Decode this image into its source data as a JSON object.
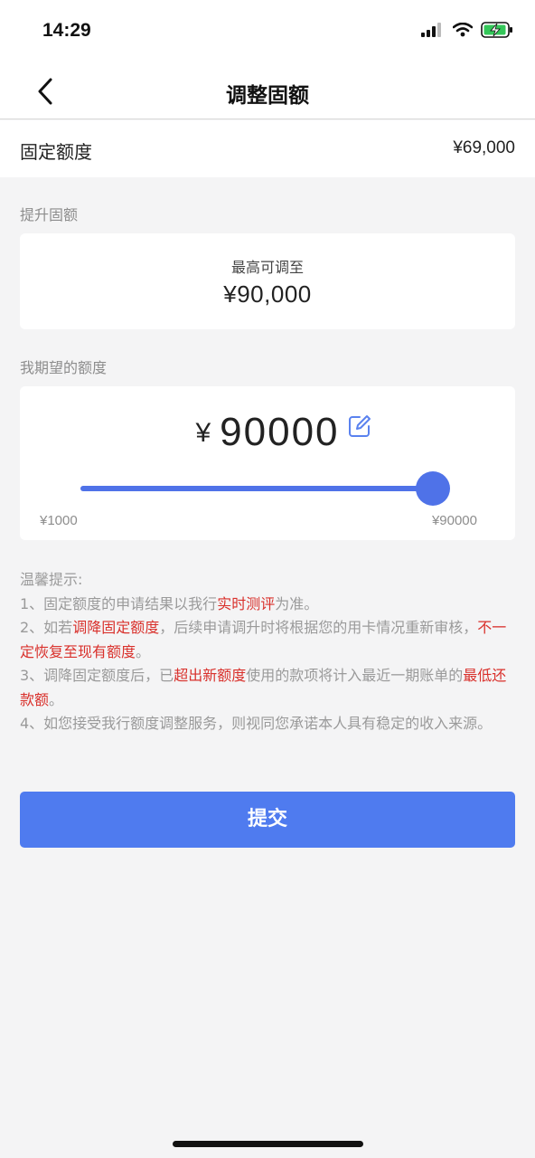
{
  "status_bar": {
    "time": "14:29"
  },
  "nav": {
    "title": "调整固额"
  },
  "fixed_quota": {
    "label": "固定额度",
    "value": "¥69,000"
  },
  "raise_section": {
    "label": "提升固额",
    "max_caption": "最高可调至",
    "max_value": "¥90,000"
  },
  "desired_section": {
    "label": "我期望的额度",
    "currency": "¥",
    "amount": "90000",
    "slider": {
      "min_label": "¥1000",
      "max_label": "¥90000",
      "min": 1000,
      "max": 90000,
      "value": 90000
    }
  },
  "tips": {
    "title": "温馨提示:",
    "item1": {
      "pre": "1、固定额度的申请结果以我行",
      "hl": "实时测评",
      "post": "为准。"
    },
    "item2": {
      "pre": "2、如若",
      "hl1": "调降固定额度",
      "mid": "，后续申请调升时将根据您的用卡情况重新审核，",
      "hl2": "不一定恢复至现有额度",
      "post": "。"
    },
    "item3": {
      "pre": "3、调降固定额度后，已",
      "hl1": "超出新额度",
      "mid": "使用的款项将计入最近一期账单的",
      "hl2": "最低还款额",
      "post": "。"
    },
    "item4": "4、如您接受我行额度调整服务，则视同您承诺本人具有稳定的收入来源。"
  },
  "submit": {
    "label": "提交"
  },
  "colors": {
    "accent": "#4f7bef",
    "highlight": "#d9312c",
    "background": "#f4f4f5"
  }
}
